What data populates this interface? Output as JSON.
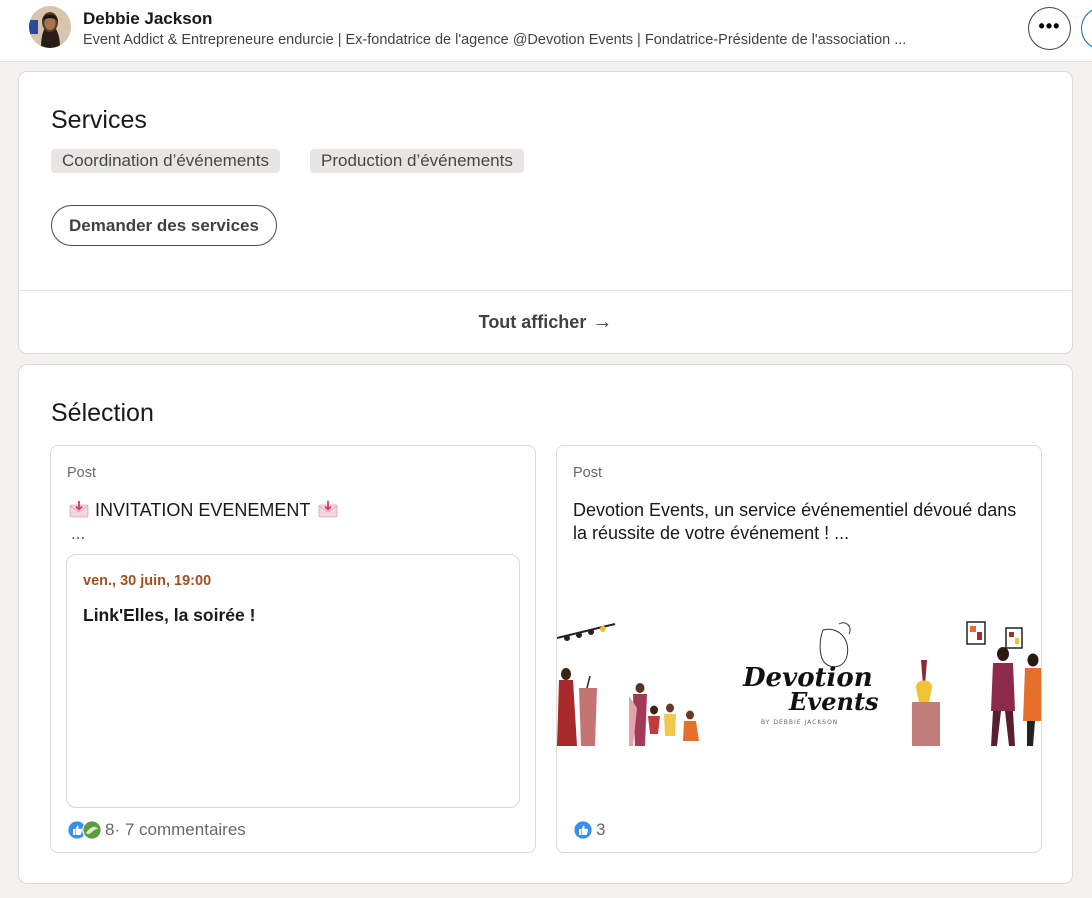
{
  "header": {
    "name": "Debbie Jackson",
    "headline": "Event Addict & Entrepreneure endurcie | Ex-fondatrice de l'agence @Devotion Events | Fondatrice-Présidente de l'association ...",
    "more_label": "•••"
  },
  "services": {
    "title": "Services",
    "chips": [
      "Coordination d’événements",
      "Production d’événements"
    ],
    "request_button": "Demander des services",
    "show_all": "Tout afficher",
    "show_all_arrow": "→"
  },
  "selection": {
    "title": "Sélection",
    "posts": [
      {
        "type": "Post",
        "text": "INVITATION EVENEMENT",
        "ellipsis": "...",
        "event": {
          "date": "ven., 30 juin, 19:00",
          "title": "Link'Elles, la soirée !"
        },
        "reaction_count": "8",
        "comments": " · 7 commentaires"
      },
      {
        "type": "Post",
        "text": "Devotion Events, un service événementiel dévoué dans la réussite de votre événement ! ...",
        "logo_text_1": "Devotion",
        "logo_text_2": "Events",
        "logo_sub": "BY DEBBIE JACKSON",
        "reaction_count": "3"
      }
    ]
  },
  "colors": {
    "linkedin_blue": "#0a66c2",
    "event_date": "#a1511f",
    "background": "#f4f2ee"
  },
  "icons": [
    "more-icon",
    "arrow-right-icon",
    "envelope-icon",
    "like-reaction-icon",
    "support-reaction-icon"
  ]
}
